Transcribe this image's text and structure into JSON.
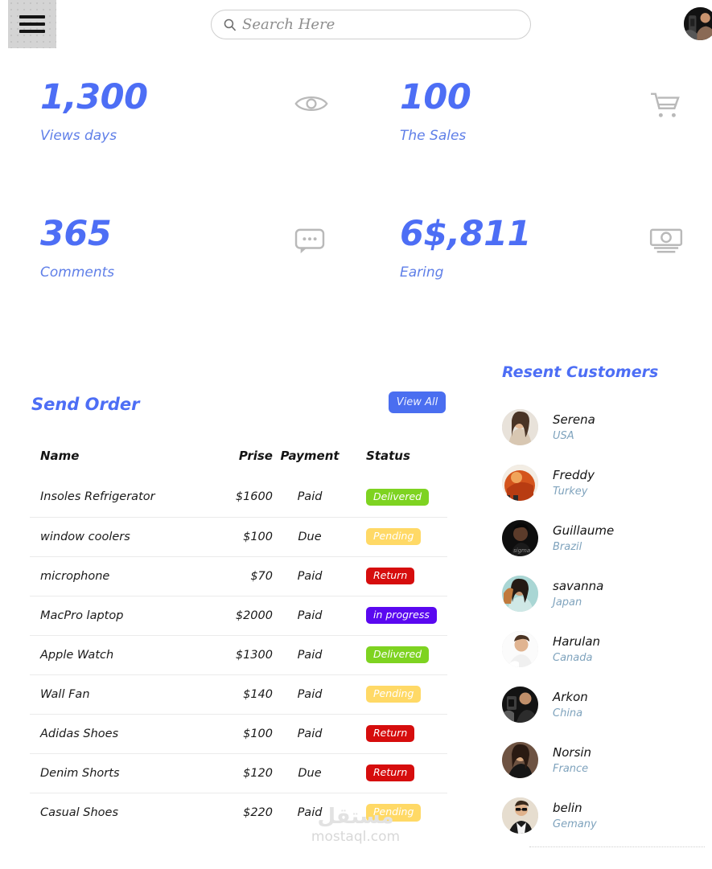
{
  "topbar": {
    "menu_icon": "hamburger-menu-icon",
    "search": {
      "icon": "search-icon",
      "placeholder": "Search Here",
      "value": ""
    },
    "avatar": "user-avatar"
  },
  "stats": [
    {
      "value": "1,300",
      "label": "Views days",
      "icon": "eye-icon"
    },
    {
      "value": "100",
      "label": "The Sales",
      "icon": "shopping-cart-icon"
    },
    {
      "value": "365",
      "label": "Comments",
      "icon": "comment-bubble-icon"
    },
    {
      "value": "6$,811",
      "label": "Earing",
      "icon": "money-banknote-icon"
    }
  ],
  "orders": {
    "title": "Send Order",
    "view_all_label": "View All",
    "columns": {
      "name": "Name",
      "price": "Prise",
      "payment": "Payment",
      "status": "Status"
    },
    "rows": [
      {
        "name": "Insoles Refrigerator",
        "price": "$1600",
        "payment": "Paid",
        "status": "Delivered",
        "status_kind": "delivered"
      },
      {
        "name": "window coolers",
        "price": "$100",
        "payment": "Due",
        "status": "Pending",
        "status_kind": "pending"
      },
      {
        "name": "microphone",
        "price": "$70",
        "payment": "Paid",
        "status": "Return",
        "status_kind": "return"
      },
      {
        "name": "MacPro laptop",
        "price": "$2000",
        "payment": "Paid",
        "status": "in progress",
        "status_kind": "inprogress"
      },
      {
        "name": "Apple Watch",
        "price": "$1300",
        "payment": "Paid",
        "status": "Delivered",
        "status_kind": "delivered"
      },
      {
        "name": "Wall Fan",
        "price": "$140",
        "payment": "Paid",
        "status": "Pending",
        "status_kind": "pending"
      },
      {
        "name": "Adidas Shoes",
        "price": "$100",
        "payment": "Paid",
        "status": "Return",
        "status_kind": "return"
      },
      {
        "name": "Denim Shorts",
        "price": "$120",
        "payment": "Due",
        "status": "Return",
        "status_kind": "return"
      },
      {
        "name": "Casual Shoes",
        "price": "$220",
        "payment": "Paid",
        "status": "Pending",
        "status_kind": "pending"
      }
    ]
  },
  "customers": {
    "title": "Resent Customers",
    "items": [
      {
        "name": "Serena",
        "country": "USA"
      },
      {
        "name": "Freddy",
        "country": "Turkey"
      },
      {
        "name": "Guillaume",
        "country": "Brazil"
      },
      {
        "name": "savanna",
        "country": "Japan"
      },
      {
        "name": "Harulan",
        "country": "Canada"
      },
      {
        "name": "Arkon",
        "country": "China"
      },
      {
        "name": "Norsin",
        "country": "France"
      },
      {
        "name": "belin",
        "country": "Gemany"
      }
    ]
  },
  "watermark": {
    "arabic": "مستقل",
    "latin": "mostaql.com"
  },
  "colors": {
    "accent_blue": "#4d6ef5",
    "button_blue": "#4a6ef0",
    "label_blue": "#5f7fe8",
    "country_blue": "#7fa3bd",
    "status_delivered": "#7ed321",
    "status_pending": "#ffd966",
    "status_return": "#d60d0d",
    "status_inprogress": "#5a08f0"
  }
}
